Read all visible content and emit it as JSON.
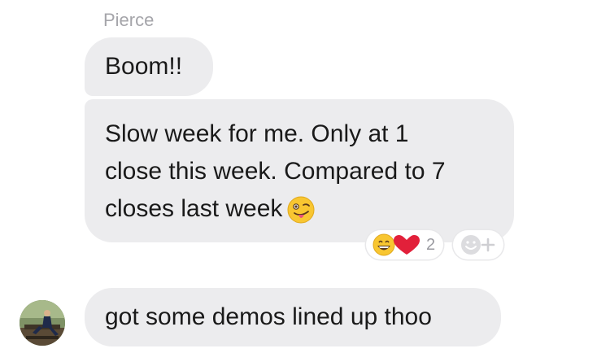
{
  "conversation": {
    "sender_name": "Pierce",
    "messages": [
      {
        "text": "Boom!!"
      },
      {
        "lines": [
          "Slow week for me. Only at 1",
          "close this week. Compared to 7",
          "closes last week"
        ],
        "trailing_emoji": "winking-face-with-tongue-icon"
      },
      {
        "text": "got some demos lined up thoo"
      }
    ],
    "reactions": {
      "icons": [
        "grinning-face-icon",
        "red-heart-icon"
      ],
      "count": "2",
      "add_icon": "add-reaction-icon"
    }
  },
  "colors": {
    "bubble_bg": "#ececee",
    "text": "#1a1a1a",
    "sender_name": "#a5a5aa",
    "heart": "#e2203a",
    "emoji_yellow": "#f8c631"
  }
}
